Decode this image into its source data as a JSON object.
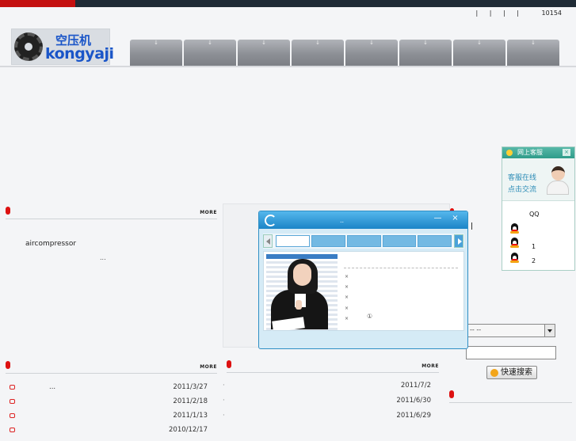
{
  "header": {
    "top_links": [
      "|",
      "|",
      "|",
      "|"
    ],
    "visitor_count": "10154",
    "logo_cn": "空压机",
    "logo_en": "kongyaji",
    "nav_items": [
      "↓",
      "↓",
      "↓",
      "↓",
      "↓",
      "↓",
      "↓",
      "↓"
    ]
  },
  "intro_section": {
    "more_label": "MORE",
    "text": "aircompressor",
    "ellipsis": "..."
  },
  "news_section": {
    "more_label": "MORE",
    "items": [
      {
        "title": "...",
        "date": "2011/3/27"
      },
      {
        "title": "",
        "date": "2011/2/18"
      },
      {
        "title": "",
        "date": "2011/1/13"
      },
      {
        "title": "",
        "date": "2010/12/17"
      }
    ]
  },
  "news2_section": {
    "more_label": "MORE",
    "items": [
      {
        "dash": "·",
        "date": "2011/7/2"
      },
      {
        "dash": "·",
        "date": "2011/6/30"
      },
      {
        "dash": "·",
        "date": "2011/6/29"
      }
    ]
  },
  "search": {
    "select_value": "--  --",
    "button_label": "快速搜索"
  },
  "chat_popup": {
    "title": "..",
    "minimize": "—",
    "close": "×",
    "bullets": [
      "×",
      "×",
      "×",
      "×",
      "×"
    ],
    "circled": "①"
  },
  "qq_panel": {
    "header": "网上客服",
    "close": "×",
    "service_line1": "客服在线",
    "service_line2": "点击交流",
    "qq_label": "QQ",
    "contacts": [
      "",
      "1",
      "2"
    ]
  },
  "colors": {
    "accent_red": "#c41010",
    "nav_gray": "#8d9096",
    "popup_blue": "#1b84c7",
    "qq_teal": "#2f9c8a"
  }
}
